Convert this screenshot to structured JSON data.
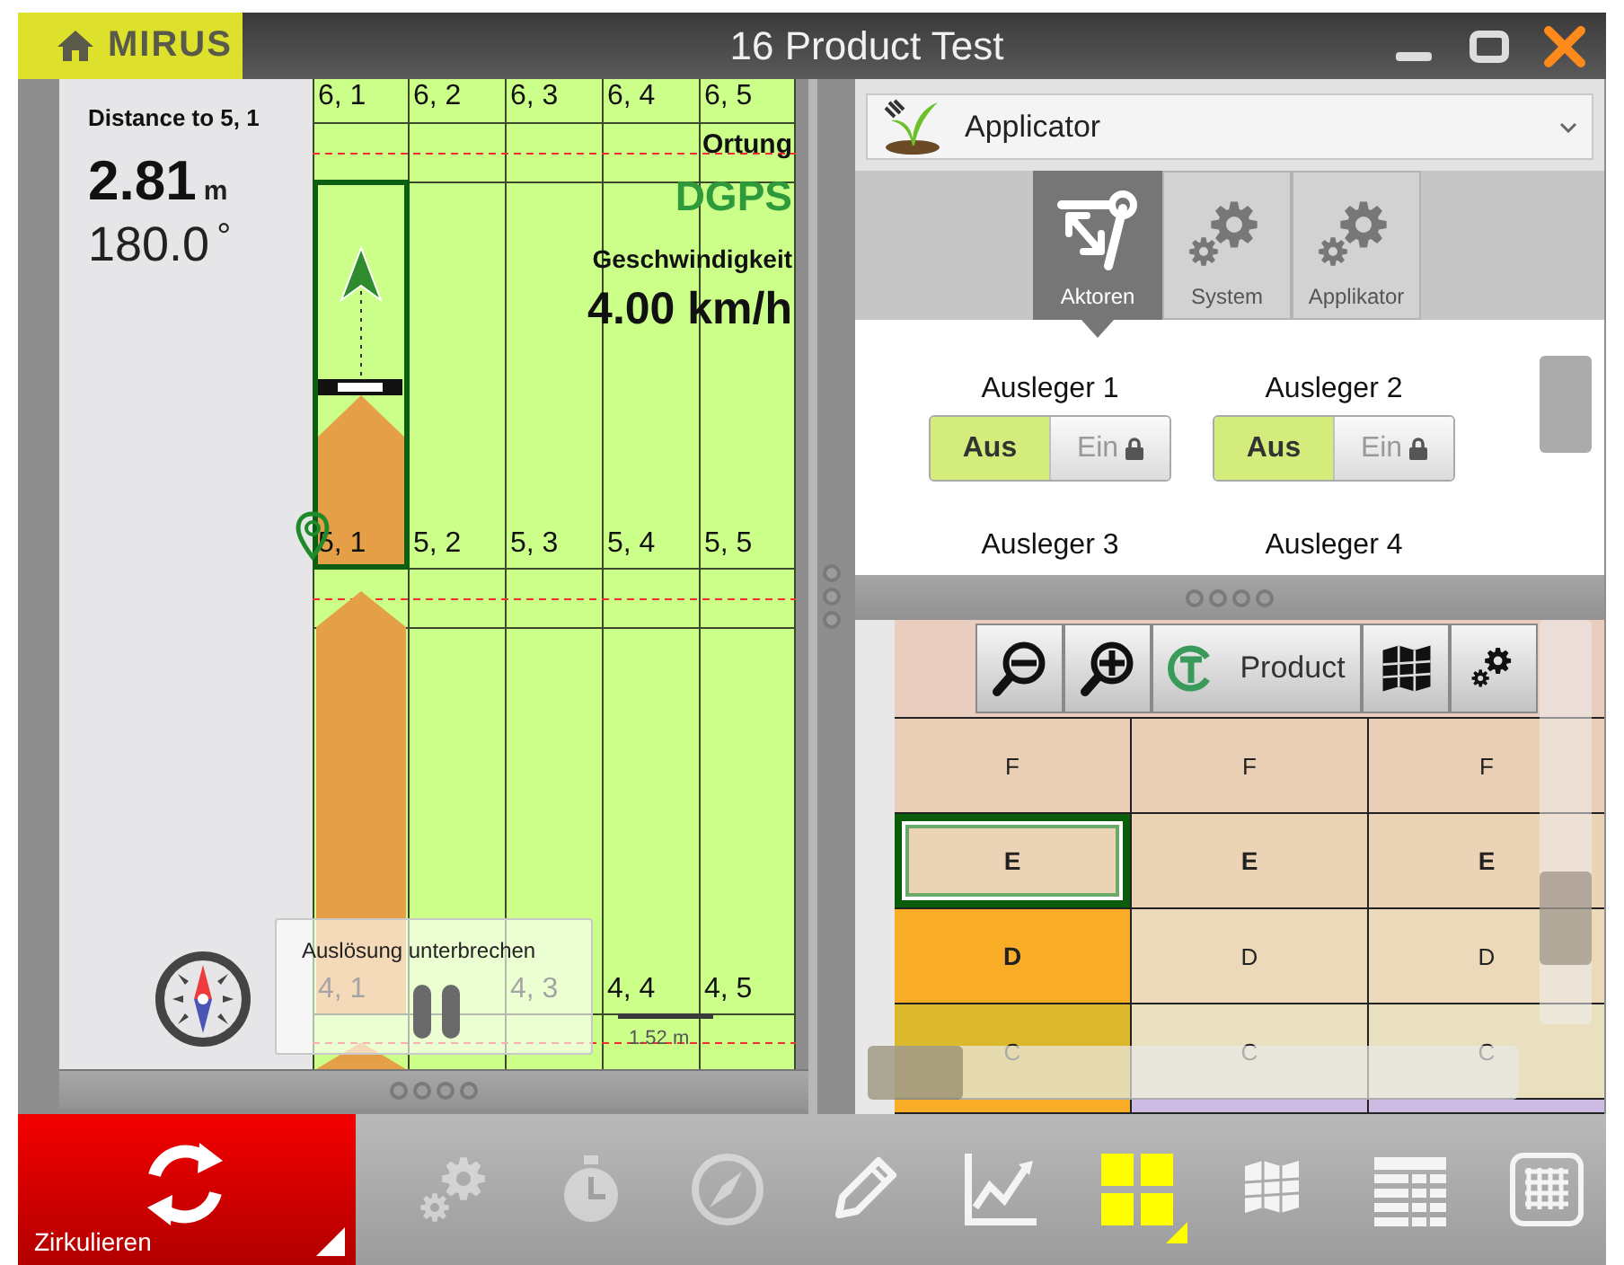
{
  "title_bar": {
    "brand": "MIRUS",
    "title": "16 Product Test"
  },
  "guidance": {
    "distance_label": "Distance to 5, 1",
    "distance": "2.81",
    "distance_unit": "m",
    "heading": "180.0",
    "heading_unit": "°"
  },
  "field_map": {
    "label_rows": [
      {
        "cells": [
          {
            "label": "6, 1"
          },
          {
            "label": "6, 2"
          },
          {
            "label": "6, 3"
          },
          {
            "label": "6, 4"
          },
          {
            "label": "6, 5"
          }
        ]
      },
      {
        "cells": [
          {
            "label": "5, 1"
          },
          {
            "label": "5, 2"
          },
          {
            "label": "5, 3"
          },
          {
            "label": "5, 4"
          },
          {
            "label": "5, 5"
          }
        ]
      },
      {
        "cells": [
          {
            "label": "4, 1"
          },
          {},
          {
            "label": "4, 3"
          },
          {
            "label": "4, 4"
          },
          {
            "label": "4, 5"
          }
        ]
      }
    ],
    "positioning_label": "Ortung",
    "positioning": "DGPS",
    "speed_label": "Geschwindigkeit",
    "speed": "4.00 km/h",
    "scale": "1.52 m"
  },
  "pause_overlay": {
    "label": "Auslösung unterbrechen"
  },
  "applicator_panel": {
    "dropdown": {
      "value": "Applicator"
    },
    "tabs": [
      {
        "label": "Aktoren",
        "kind": "actuators",
        "selected": true
      },
      {
        "label": "System",
        "kind": "gears",
        "selected": false
      },
      {
        "label": "Applikator",
        "kind": "gears",
        "selected": false
      }
    ],
    "booms": [
      {
        "name": "Ausleger 1",
        "switch": {
          "off_label": "Aus",
          "on_label": "Ein",
          "on": false,
          "locked": true
        }
      },
      {
        "name": "Ausleger 2",
        "switch": {
          "off_label": "Aus",
          "on_label": "Ein",
          "on": false,
          "locked": true
        }
      },
      {
        "name": "Ausleger 3"
      },
      {
        "name": "Ausleger 4"
      }
    ]
  },
  "grid": {
    "header": {
      "color": "#e9cdbf"
    },
    "toolbar": {
      "product": "Product"
    },
    "rows": [
      {
        "cells": [
          {
            "text": "F",
            "bold": false,
            "color": "#e9cfb5",
            "selected": false
          },
          {
            "text": "F",
            "bold": false,
            "color": "#e9cfb5",
            "selected": false
          },
          {
            "text": "F",
            "bold": false,
            "color": "#e9cfb5",
            "selected": false
          }
        ]
      },
      {
        "cells": [
          {
            "text": "E",
            "bold": true,
            "color": "#ebd3b6",
            "selected": true
          },
          {
            "text": "E",
            "bold": true,
            "color": "#ebd3b6",
            "selected": false
          },
          {
            "text": "E",
            "bold": true,
            "color": "#ebd3b6",
            "selected": false
          }
        ]
      },
      {
        "cells": [
          {
            "text": "D",
            "bold": true,
            "color": "#f9ad27",
            "selected": false
          },
          {
            "text": "D",
            "bold": false,
            "color": "#ecd9ba",
            "selected": false
          },
          {
            "text": "D",
            "bold": false,
            "color": "#ecd9ba",
            "selected": false
          }
        ]
      },
      {
        "cells": [
          {
            "text": "C",
            "bold": false,
            "color": "#dcb92c",
            "selected": false
          },
          {
            "text": "C",
            "bold": false,
            "color": "#e9e0c0",
            "selected": false
          },
          {
            "text": "C",
            "bold": false,
            "color": "#e9e0c0",
            "selected": false
          }
        ]
      },
      {
        "cells": [
          {
            "color": "#f9ad27",
            "selected": false
          },
          {
            "color": "#cdbbe3",
            "selected": false
          },
          {
            "color": "#cdbbe3",
            "selected": false
          }
        ]
      }
    ]
  },
  "bottom_bar": {
    "circulate": {
      "label": "Zirkulieren"
    },
    "tools": [
      {
        "kind": "settings",
        "disabled": true,
        "selected": false
      },
      {
        "kind": "stopwatch",
        "disabled": true,
        "selected": false
      },
      {
        "kind": "compass",
        "disabled": true,
        "selected": false
      },
      {
        "kind": "pencil",
        "disabled": false,
        "selected": false
      },
      {
        "kind": "chart",
        "disabled": false,
        "selected": false
      },
      {
        "kind": "tiles",
        "disabled": false,
        "selected": true
      },
      {
        "kind": "map",
        "disabled": false,
        "selected": false
      },
      {
        "kind": "table",
        "disabled": false,
        "selected": false
      },
      {
        "kind": "keypad",
        "disabled": false,
        "selected": false
      }
    ]
  }
}
